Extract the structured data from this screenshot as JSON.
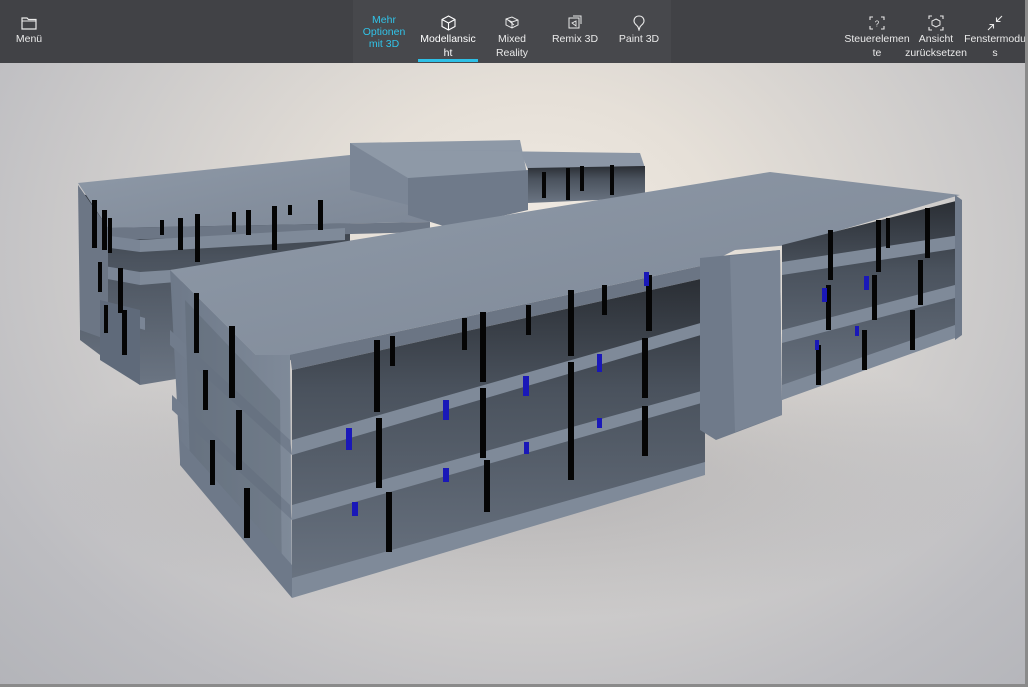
{
  "toolbar": {
    "menu": {
      "label": "Menü",
      "icon": "folder-icon"
    },
    "more_options": {
      "label": "Mehr Optionen mit 3D",
      "line1": "Mehr",
      "line2": "Optionen",
      "line3": "mit 3D"
    },
    "tabs": [
      {
        "line1": "Modellansic",
        "line2": "ht",
        "icon": "cube-icon",
        "active": true
      },
      {
        "line1": "Mixed",
        "line2": "Reality",
        "icon": "mixed-reality-icon",
        "active": false
      },
      {
        "line1": "Remix 3D",
        "line2": "",
        "icon": "remix-3d-icon",
        "active": false
      },
      {
        "line1": "Paint 3D",
        "line2": "",
        "icon": "paint-3d-icon",
        "active": false
      }
    ],
    "right": [
      {
        "line1": "Steuerelemen",
        "line2": "te",
        "icon": "controls-icon"
      },
      {
        "line1": "Ansicht",
        "line2": "zurücksetzen",
        "icon": "reset-view-icon"
      },
      {
        "line1": "Fenstermodu",
        "line2": "s",
        "icon": "window-mode-icon"
      }
    ]
  },
  "colors": {
    "toolbar_bg": "#414246",
    "accent": "#2ec0e6",
    "building": "#7b8797",
    "window_column": "#000000",
    "blue_column": "#1a18b8"
  }
}
